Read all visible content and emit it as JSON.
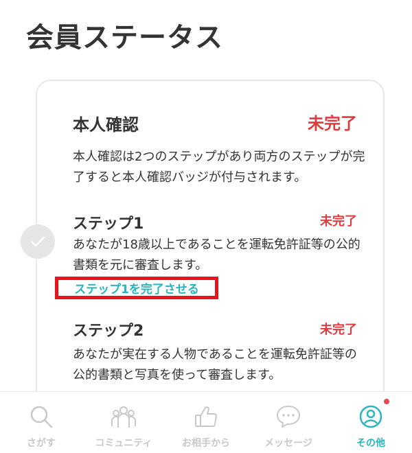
{
  "page": {
    "title": "会員ステータス"
  },
  "verification": {
    "title": "本人確認",
    "status": "未完了",
    "description": "本人確認は2つのステップがあり両方のステップが完了すると本人確認バッジが付与されます。"
  },
  "steps": [
    {
      "title": "ステップ1",
      "status": "未完了",
      "description": "あなたが18歳以上であることを運転免許証等の公的書類を元に審査します。",
      "action_label": "ステップ1を完了させる"
    },
    {
      "title": "ステップ2",
      "status": "未完了",
      "description": "あなたが実在する人物であることを運転免許証等の公的書類と写真を使って審査します。"
    }
  ],
  "tabs": [
    {
      "label": "さがす",
      "icon": "search-icon",
      "active": false
    },
    {
      "label": "コミュニティ",
      "icon": "community-icon",
      "active": false
    },
    {
      "label": "お相手から",
      "icon": "thumbs-up-icon",
      "active": false
    },
    {
      "label": "メッセージ",
      "icon": "message-icon",
      "active": false
    },
    {
      "label": "その他",
      "icon": "user-circle-icon",
      "active": true,
      "badge": true
    }
  ],
  "colors": {
    "accent": "#27b5c2",
    "incomplete": "#e0393e",
    "highlight_border": "#e8141b",
    "inactive": "#c8c8c8"
  }
}
